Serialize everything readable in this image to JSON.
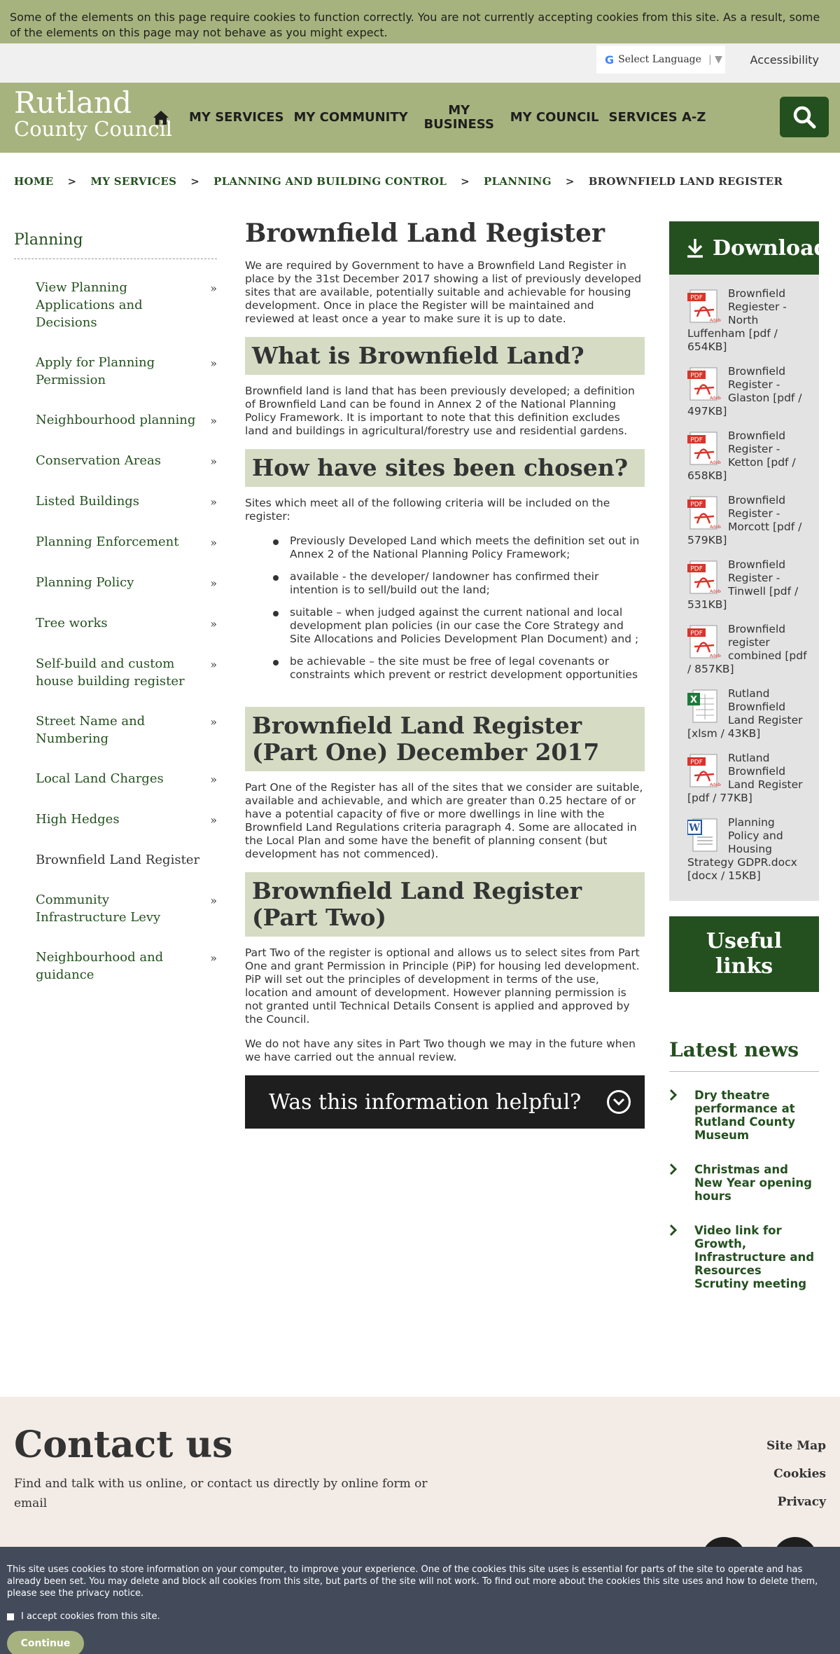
{
  "cookie_top": {
    "text": "Some of the elements on this page require cookies to function correctly. You are not currently accepting cookies from this site. As a result, some of the elements on this page may not behave as you might expect."
  },
  "utility": {
    "language_label": "Select Language",
    "accessibility_label": "Accessibility"
  },
  "header": {
    "logo_line1": "Rutland",
    "logo_line2": "County Council",
    "nav": [
      "MY SERVICES",
      "MY COMMUNITY",
      "MY BUSINESS",
      "MY COUNCIL",
      "SERVICES A-Z"
    ]
  },
  "breadcrumb": [
    "HOME",
    "MY SERVICES",
    "PLANNING AND BUILDING CONTROL",
    "PLANNING",
    "BROWNFIELD LAND REGISTER"
  ],
  "sidebar": {
    "title": "Planning",
    "items": [
      "View Planning Applications and Decisions",
      "Apply for Planning Permission",
      "Neighbourhood planning",
      "Conservation Areas",
      "Listed Buildings",
      "Planning Enforcement",
      "Planning Policy",
      "Tree works",
      "Self-build and custom house building register",
      "Street Name and Numbering",
      "Local Land Charges",
      "High Hedges",
      "Brownfield Land Register",
      "Community Infrastructure Levy",
      "Neighbourhood and guidance"
    ]
  },
  "main": {
    "title": "Brownfield Land Register",
    "intro": "We are required by Government to have a Brownfield Land Register in place by the 31st December 2017 showing a list of previously developed sites that are available, potentially suitable and achievable for housing development. Once in place the Register will be maintained and reviewed at least once a year to make sure it is up to date.",
    "h_what": "What is Brownfield Land?",
    "p_what": "Brownfield land is land that has been previously developed; a definition of Brownfield Land can be found in Annex 2 of the National Planning Policy Framework. It is important to note that this definition excludes land and buildings in agricultural/forestry use and residential gardens.",
    "h_how": "How have sites been chosen?",
    "p_how": "Sites which meet  all of the following criteria will be included on the register:",
    "bullets": [
      "Previously Developed Land which meets the definition set out in Annex 2 of the National Planning Policy Framework;",
      "available  - the developer/ landowner has confirmed their intention is to sell/build out the land;",
      "suitable – when judged against the current  national and local development plan policies (in our case the Core Strategy and Site Allocations and Policies Development Plan Document) and ;",
      "be achievable – the site must be free of legal covenants or constraints which prevent or restrict development opportunities"
    ],
    "h_part1": "Brownfield Land Register (Part One) December 2017",
    "p_part1": "Part One of the Register has all of the sites that we consider are suitable, available and achievable, and which are greater than 0.25 hectare of or have a potential capacity of five or more dwellings in line with the Brownfield Land Regulations criteria paragraph 4.  Some are allocated in the Local Plan and some have the benefit of planning consent (but development has not commenced).",
    "h_part2": "Brownfield Land Register (Part Two)",
    "p_part2": "Part Two of the register is optional and allows us to select sites from Part One and grant Permission in Principle (PiP) for housing led development.  PiP will set out the principles of development in terms of the use, location and amount of development.  However planning permission is not granted until Technical Details Consent is applied and approved by the Council.",
    "p_part2b": "We do not have any sites in Part Two though we may in the future when we have carried out the annual review.",
    "helpful": "Was this information helpful?"
  },
  "downloads": {
    "title": "Download",
    "items": [
      {
        "type": "pdf",
        "label": "Brownfield Regiester - North Luffenham [pdf / 654KB]"
      },
      {
        "type": "pdf",
        "label": "Brownfield Register - Glaston [pdf / 497KB]"
      },
      {
        "type": "pdf",
        "label": "Brownfield Register - Ketton [pdf / 658KB]"
      },
      {
        "type": "pdf",
        "label": "Brownfield Register - Morcott [pdf / 579KB]"
      },
      {
        "type": "pdf",
        "label": "Brownfield Register - Tinwell [pdf / 531KB]"
      },
      {
        "type": "pdf",
        "label": "Brownfield register combined [pdf / 857KB]"
      },
      {
        "type": "xlsx",
        "label": "Rutland Brownfield Land Register [xlsm / 43KB]"
      },
      {
        "type": "pdf",
        "label": "Rutland Brownfield Land Register [pdf / 77KB]"
      },
      {
        "type": "docx",
        "label": "Planning Policy and Housing Strategy GDPR.docx [docx / 15KB]"
      }
    ]
  },
  "useful_links": "Useful links",
  "news": {
    "title": "Latest news",
    "items": [
      "Dry theatre performance at Rutland County Museum",
      "Christmas and New Year opening hours",
      "Video link for Growth, Infrastructure and Resources Scrutiny meeting"
    ]
  },
  "footer": {
    "contact_title": "Contact us",
    "contact_text": "Find and talk with us online, or contact us directly by online form or email",
    "links": [
      "Site Map",
      "Cookies",
      "Privacy"
    ]
  },
  "cookie_bottom": {
    "text": "This site uses cookies to store information on your computer, to improve your experience. One of the cookies this site uses is essential for parts of the site to operate and has already been set. You may delete and block all cookies from this site, but parts of the site will not work. To find out more about the cookies this site uses and how to delete them, please see the privacy notice.",
    "accept_label": "I accept cookies from this site.",
    "continue_label": "Continue"
  },
  "colors": {
    "brand_green": "#24501f",
    "header_olive": "#a7b37e",
    "section_bg": "#d6dcc4",
    "pdf_red": "#d9342b",
    "excel_green": "#1d7a3a",
    "word_blue": "#2b579a"
  }
}
